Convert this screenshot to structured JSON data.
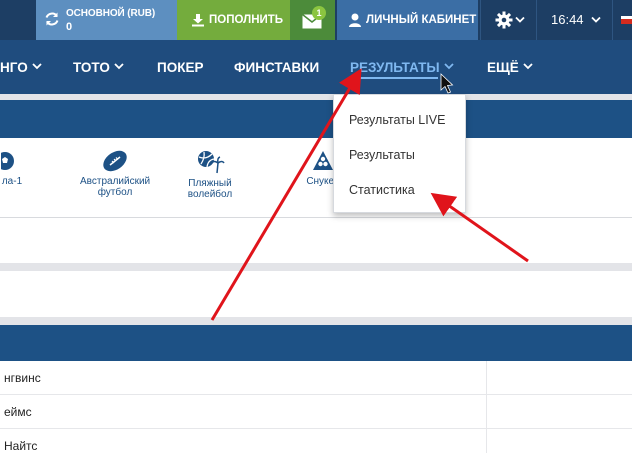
{
  "topbar": {
    "balance_label": "ОСНОВНОЙ (RUB)",
    "balance_amount": "0",
    "deposit_label": "ПОПОЛНИТЬ",
    "mail_badge": "1",
    "cabinet_label": "ЛИЧНЫЙ КАБИНЕТ",
    "time": "16:44"
  },
  "nav": {
    "items": [
      {
        "label": "НГО"
      },
      {
        "label": "ТОТО"
      },
      {
        "label": "ПОКЕР"
      },
      {
        "label": "ФИНСТАВКИ"
      },
      {
        "label": "РЕЗУЛЬТАТЫ"
      },
      {
        "label": "ЕЩЁ"
      }
    ]
  },
  "dropdown": {
    "items": [
      {
        "label": "Результаты LIVE"
      },
      {
        "label": "Результаты"
      },
      {
        "label": "Статистика"
      }
    ]
  },
  "sports": [
    {
      "label": "ла-1",
      "icon": "soccer-ball-icon"
    },
    {
      "label": "Австралийский футбол",
      "icon": "australian-football-icon"
    },
    {
      "label": "Пляжный волейбол",
      "icon": "beach-volleyball-icon"
    },
    {
      "label": "Снукер",
      "icon": "snooker-icon"
    }
  ],
  "table": {
    "rows": [
      {
        "name": "нгвинс"
      },
      {
        "name": "еймс"
      },
      {
        "name": "Найтс"
      }
    ]
  },
  "colors": {
    "topbar": "#1d3e64",
    "nav": "#1f4c7e",
    "balance": "#5d8fc0",
    "deposit": "#74ac3d",
    "cabinet": "#3b6ea5",
    "active_nav": "#7fb8f0",
    "annotation_arrow": "#e0141b"
  }
}
